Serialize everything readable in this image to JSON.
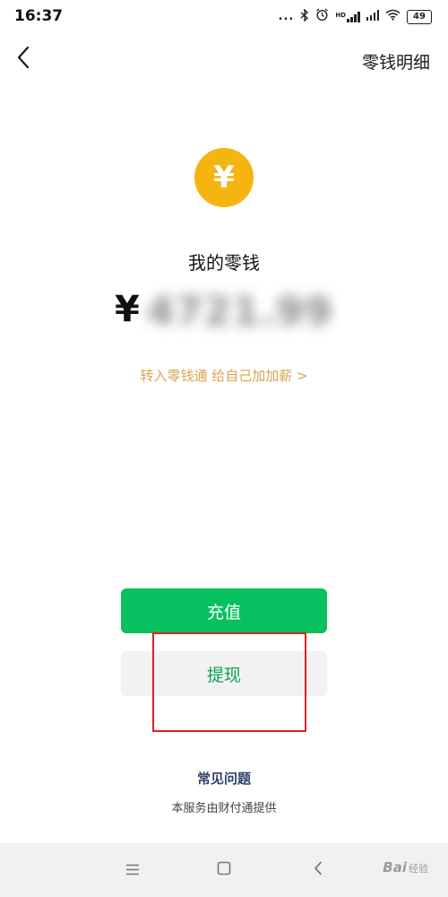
{
  "status_bar": {
    "time": "16:37",
    "dots": "...",
    "hd_label": "HD",
    "battery": "49"
  },
  "header": {
    "back_icon": "chevron-left-icon",
    "right_link": "零钱明细"
  },
  "wallet": {
    "coin_icon": "yuan-coin-icon",
    "coin_symbol": "¥",
    "label": "我的零钱",
    "currency_symbol": "¥",
    "amount": "4721.99",
    "amount_blurred": true,
    "promo": "转入零钱通 给自己加加薪 >"
  },
  "actions": {
    "recharge_label": "充值",
    "withdraw_label": "提现"
  },
  "footer": {
    "faq_label": "常见问题",
    "provider_note": "本服务由财付通提供"
  },
  "watermark": {
    "text": "Bai",
    "suffix": "经验"
  },
  "colors": {
    "brand_green": "#07c160",
    "coin_yellow": "#f5b40f",
    "promo_gold": "#d9a650",
    "highlight_red": "#e02020"
  }
}
